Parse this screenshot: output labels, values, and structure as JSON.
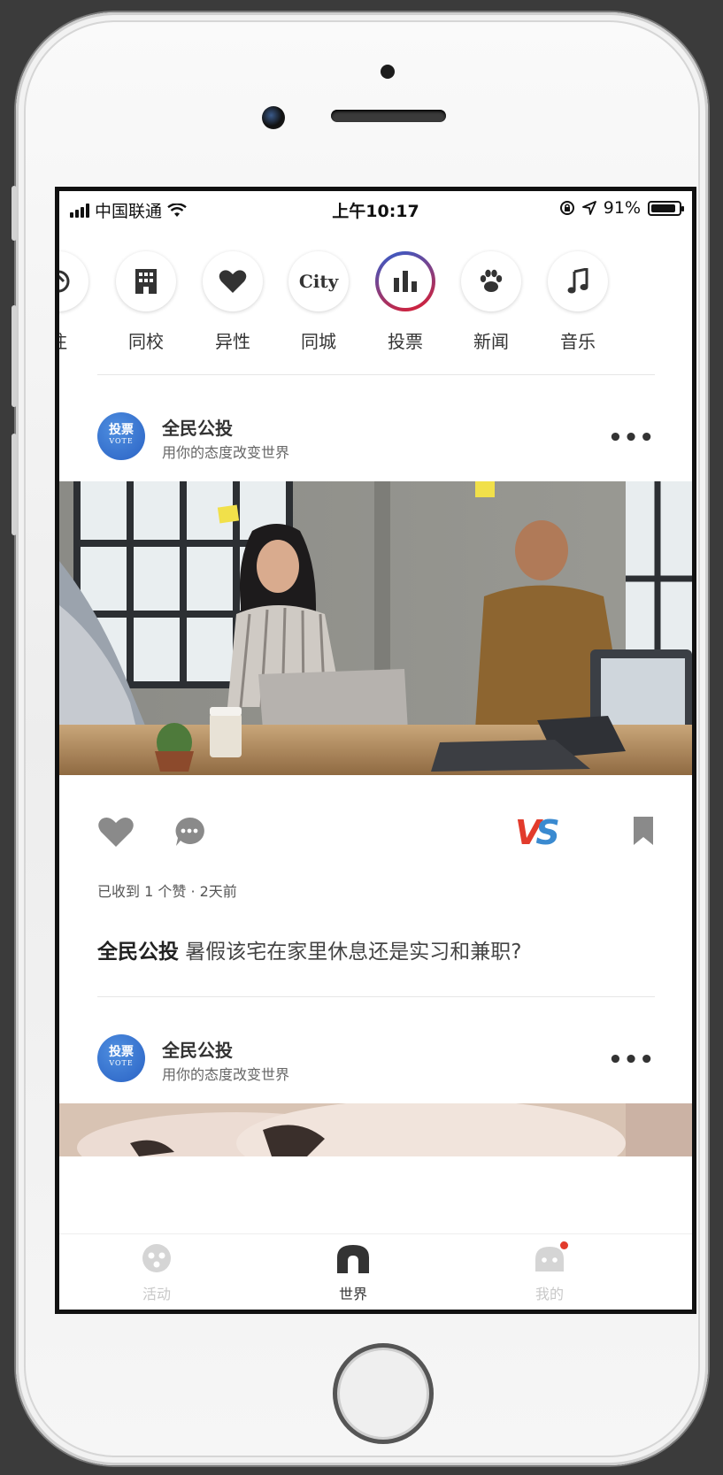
{
  "status_bar": {
    "carrier": "中国联通",
    "time": "上午10:17",
    "battery": "91%",
    "battery_level": 0.91
  },
  "categories": [
    {
      "label": "注",
      "icon": "sticker-icon"
    },
    {
      "label": "同校",
      "icon": "building-icon"
    },
    {
      "label": "异性",
      "icon": "heart-icon"
    },
    {
      "label": "同城",
      "icon": "city-icon",
      "icon_text": "City"
    },
    {
      "label": "投票",
      "icon": "bar-chart-icon",
      "active": true
    },
    {
      "label": "新闻",
      "icon": "paw-icon"
    },
    {
      "label": "音乐",
      "icon": "music-note-icon"
    }
  ],
  "posts": [
    {
      "author": "全民公投",
      "subtitle": "用你的态度改变世界",
      "avatar_text": "投票",
      "avatar_subtext": "VOTE",
      "likes_text": "已收到 1 个赞 · 2天前",
      "caption_author": "全民公投",
      "caption_text": " 暑假该宅在家里休息还是实习和兼职?"
    },
    {
      "author": "全民公投",
      "subtitle": "用你的态度改变世界",
      "avatar_text": "投票",
      "avatar_subtext": "VOTE"
    }
  ],
  "vs_badge": "VS",
  "tabbar": [
    {
      "label": "活动",
      "icon": "activity-icon"
    },
    {
      "label": "世界",
      "icon": "world-icon",
      "active": true
    },
    {
      "label": "我的",
      "icon": "profile-icon",
      "badge": true
    }
  ],
  "colors": {
    "accent_blue": "#2f5fd0",
    "accent_red": "#e21b2c",
    "badge_red": "#e23b2c"
  }
}
